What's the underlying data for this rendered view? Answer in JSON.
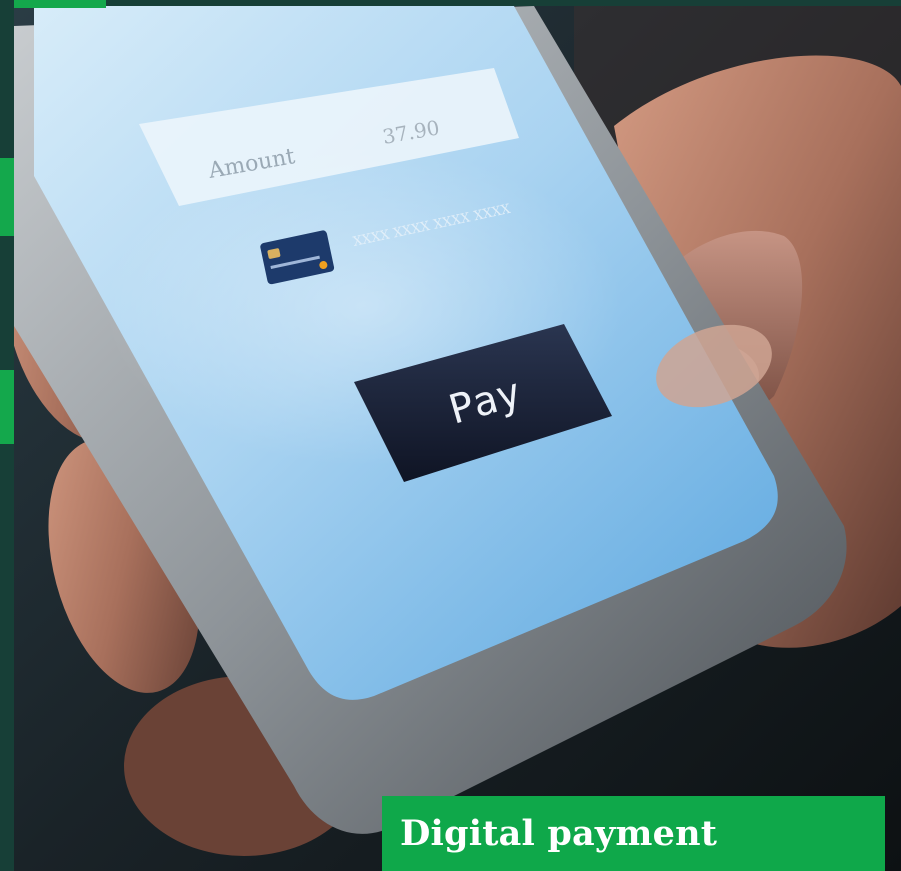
{
  "photo": {
    "amount_label": "Amount",
    "amount_value": "37.90",
    "card_number": "XXXX XXXX XXXX XXXX",
    "pay_button_label": "Pay"
  },
  "caption": {
    "text": "Digital payment"
  },
  "colors": {
    "accent_green": "#14a84c",
    "dark_teal": "#173f37",
    "caption_green": "#0fa84a"
  }
}
